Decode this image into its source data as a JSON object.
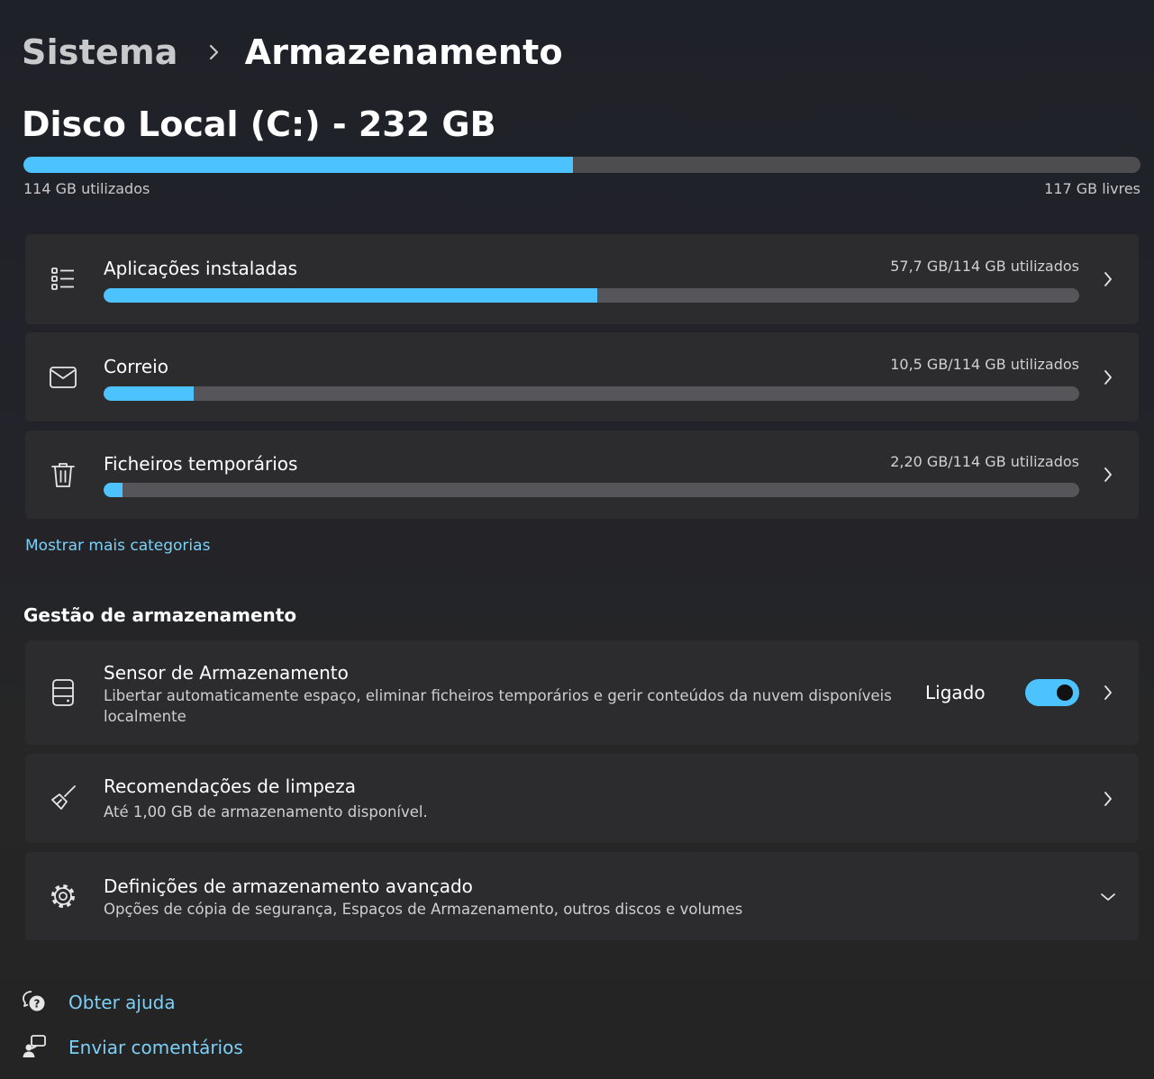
{
  "breadcrumb": {
    "parent": "Sistema",
    "current": "Armazenamento"
  },
  "disk": {
    "title": "Disco Local (C:) - 232 GB",
    "used_label": "114 GB utilizados",
    "free_label": "117 GB livres",
    "used_fraction": 0.492
  },
  "categories": [
    {
      "label": "Aplicações instaladas",
      "value": "57,7 GB/114 GB utilizados",
      "fraction": 0.506,
      "icon": "apps-list-icon"
    },
    {
      "label": "Correio",
      "value": "10,5 GB/114 GB utilizados",
      "fraction": 0.092,
      "icon": "mail-icon"
    },
    {
      "label": "Ficheiros temporários",
      "value": "2,20 GB/114 GB utilizados",
      "fraction": 0.019,
      "icon": "trash-icon"
    }
  ],
  "show_more": "Mostrar mais categorias",
  "management": {
    "title": "Gestão de armazenamento",
    "sensor": {
      "title": "Sensor de Armazenamento",
      "desc_line1": "Libertar automaticamente espaço, eliminar ficheiros temporários e gerir conteúdos da nuvem disponíveis",
      "desc_line2": "localmente",
      "status": "Ligado",
      "enabled": true
    },
    "cleanup": {
      "title": "Recomendações de limpeza",
      "desc": "Até 1,00 GB de armazenamento disponível."
    },
    "advanced": {
      "title": "Definições de armazenamento avançado",
      "desc": "Opções de cópia de segurança, Espaços de Armazenamento, outros discos e volumes"
    }
  },
  "footer": {
    "help": "Obter ajuda",
    "feedback": "Enviar comentários"
  },
  "colors": {
    "accent": "#4cc2ff",
    "link": "#7cd0f5",
    "card": "#2c2c2e",
    "track": "#55555a"
  }
}
